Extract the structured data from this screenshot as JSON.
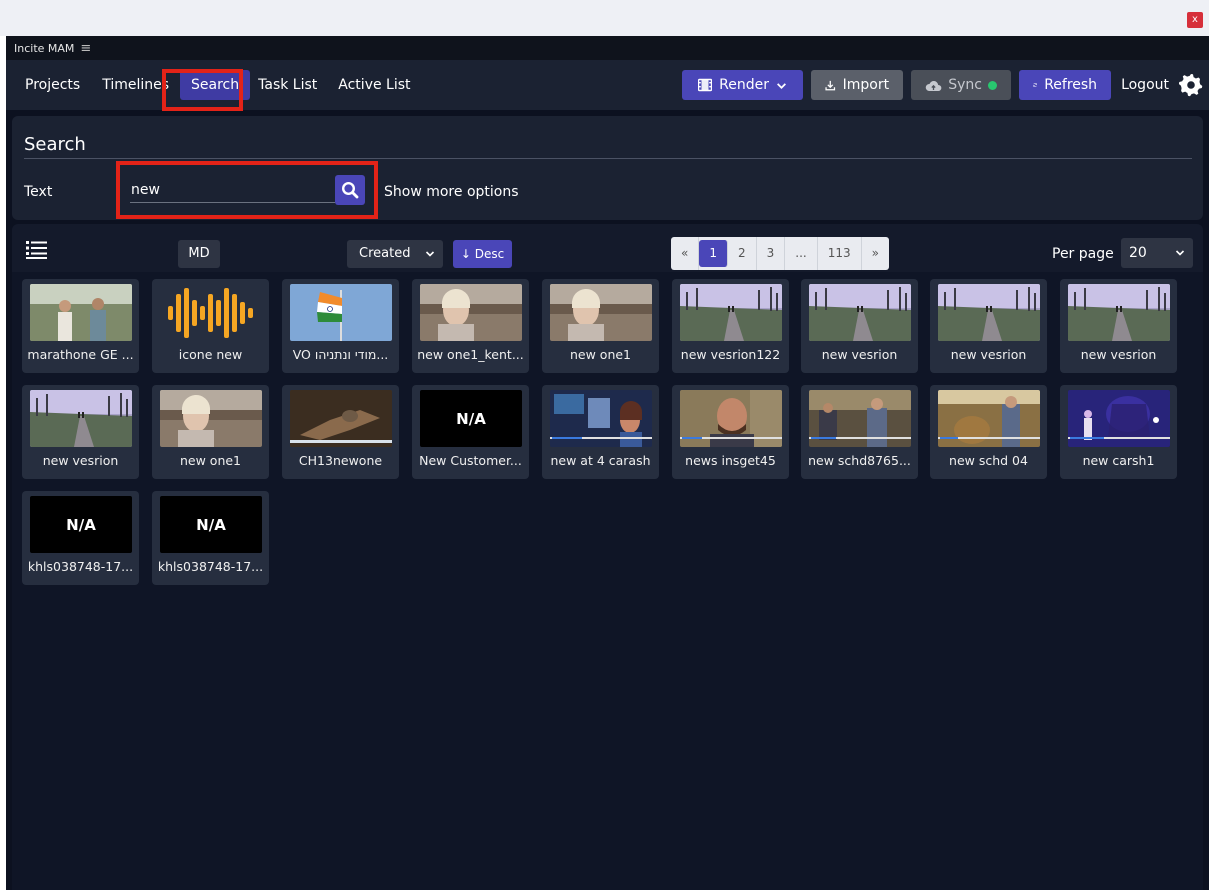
{
  "window": {
    "close_label": "x",
    "title": "Incite MAM",
    "menu_glyph": "≡"
  },
  "nav": {
    "items": [
      {
        "label": "Projects",
        "active": false
      },
      {
        "label": "Timelines",
        "active": false
      },
      {
        "label": "Search",
        "active": true
      },
      {
        "label": "Task List",
        "active": false
      },
      {
        "label": "Active List",
        "active": false
      }
    ],
    "render_label": "Render",
    "import_label": "Import",
    "sync_label": "Sync",
    "refresh_label": "Refresh",
    "logout_label": "Logout"
  },
  "search": {
    "title": "Search",
    "text_label": "Text",
    "value": "new",
    "more_options": "Show more options"
  },
  "results": {
    "md_label": "MD",
    "sort_value": "Created",
    "order_label": "↓ Desc",
    "pages": [
      "«",
      "1",
      "2",
      "3",
      "...",
      "113",
      "»"
    ],
    "current_page": "1",
    "per_page_label": "Per page",
    "per_page_value": "20",
    "items": [
      {
        "label": "marathone GE ...",
        "thumb": "people"
      },
      {
        "label": "icone new",
        "thumb": "waves"
      },
      {
        "label": "VO מודי ונתניהו...",
        "thumb": "flag"
      },
      {
        "label": "new one1_kent...",
        "thumb": "woman"
      },
      {
        "label": "new one1",
        "thumb": "woman"
      },
      {
        "label": "new vesrion122",
        "thumb": "path"
      },
      {
        "label": "new vesrion",
        "thumb": "path"
      },
      {
        "label": "new vesrion",
        "thumb": "path"
      },
      {
        "label": "new vesrion",
        "thumb": "path"
      },
      {
        "label": "new vesrion",
        "thumb": "path"
      },
      {
        "label": "new one1",
        "thumb": "woman"
      },
      {
        "label": "CH13newone",
        "thumb": "statue"
      },
      {
        "label": "New Customer...",
        "thumb": "na",
        "na_text": "N/A"
      },
      {
        "label": "new at 4 carash",
        "thumb": "studio"
      },
      {
        "label": "news insget45",
        "thumb": "man"
      },
      {
        "label": "new schd8765...",
        "thumb": "room"
      },
      {
        "label": "new schd 04",
        "thumb": "room2"
      },
      {
        "label": "new carsh1",
        "thumb": "stage"
      },
      {
        "label": "khls038748-17...",
        "thumb": "na",
        "na_text": "N/A"
      },
      {
        "label": "khls038748-17...",
        "thumb": "na",
        "na_text": "N/A"
      }
    ]
  },
  "colors": {
    "accent": "#4a46b8",
    "highlight": "#e32318",
    "sync_dot": "#28c76f",
    "panel": "#1b2232",
    "background": "#0c1120"
  }
}
